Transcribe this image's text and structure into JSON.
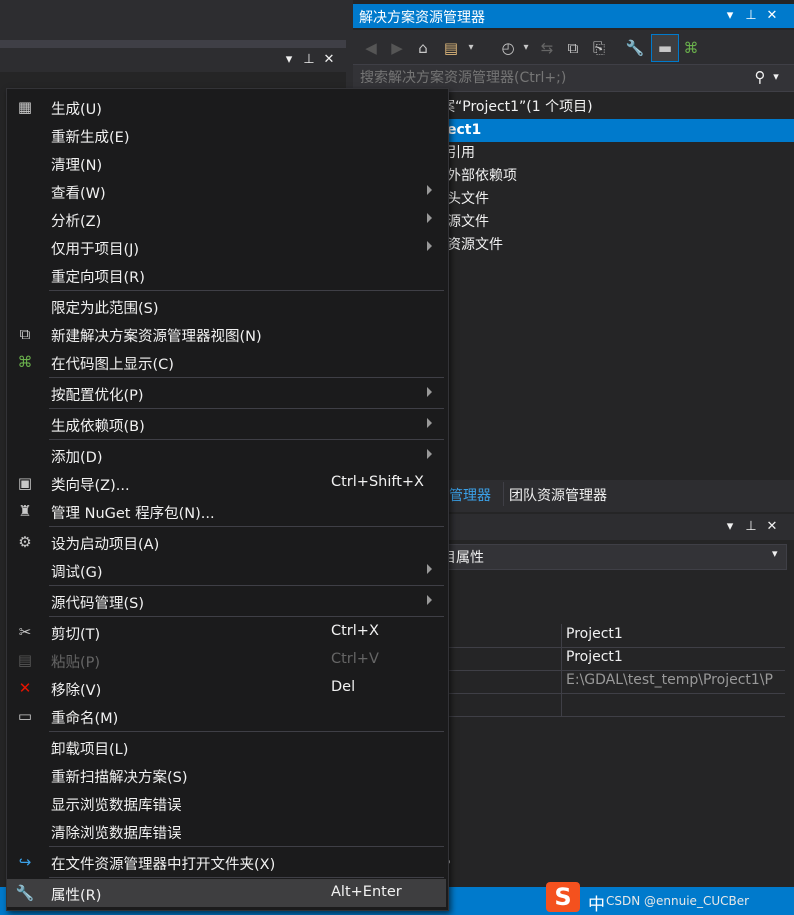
{
  "solution_explorer": {
    "title": "解决方案资源管理器",
    "search_placeholder": "搜索解决方案资源管理器(Ctrl+;)",
    "tree": [
      {
        "text": "案“Project1”(1 个项目)",
        "selected": false
      },
      {
        "text": "ect1",
        "selected": true
      },
      {
        "text": "引用",
        "selected": false
      },
      {
        "text": "外部依赖项",
        "selected": false
      },
      {
        "text": "头文件",
        "selected": false
      },
      {
        "text": "源文件",
        "selected": false
      },
      {
        "text": "资源文件",
        "selected": false
      }
    ],
    "bottom_tabs": [
      "管理器",
      "团队资源管理器"
    ]
  },
  "properties": {
    "combo_text": "目属性",
    "rows": [
      {
        "value": "Project1"
      },
      {
        "value": "Project1"
      },
      {
        "value": "E:\\GDAL\\test_temp\\Project1\\P"
      },
      {
        "value": ""
      }
    ],
    "footer_text": "。"
  },
  "ime": {
    "logo": "S",
    "lang": "中",
    "watermark": "CSDN @ennuie_CUCBer"
  },
  "context_menu": {
    "items": [
      {
        "id": "build",
        "label": "生成(U)",
        "icon": "build-icon",
        "glyph": "▦",
        "shortcut": "",
        "submenu": false,
        "disabled": false
      },
      {
        "id": "rebuild",
        "label": "重新生成(E)",
        "icon": "",
        "glyph": "",
        "shortcut": "",
        "submenu": false,
        "disabled": false
      },
      {
        "id": "clean",
        "label": "清理(N)",
        "icon": "",
        "glyph": "",
        "shortcut": "",
        "submenu": false,
        "disabled": false
      },
      {
        "id": "view",
        "label": "查看(W)",
        "icon": "",
        "glyph": "",
        "shortcut": "",
        "submenu": true,
        "disabled": false
      },
      {
        "id": "analyze",
        "label": "分析(Z)",
        "icon": "",
        "glyph": "",
        "shortcut": "",
        "submenu": true,
        "disabled": false
      },
      {
        "id": "project-only",
        "label": "仅用于项目(J)",
        "icon": "",
        "glyph": "",
        "shortcut": "",
        "submenu": true,
        "disabled": false
      },
      {
        "id": "retarget",
        "label": "重定向项目(R)",
        "icon": "",
        "glyph": "",
        "shortcut": "",
        "submenu": false,
        "disabled": false
      },
      {
        "id": "scope",
        "label": "限定为此范围(S)",
        "icon": "",
        "glyph": "",
        "shortcut": "",
        "submenu": false,
        "disabled": false
      },
      {
        "id": "new-view",
        "label": "新建解决方案资源管理器视图(N)",
        "icon": "new-view-icon",
        "glyph": "⧉",
        "shortcut": "",
        "submenu": false,
        "disabled": false
      },
      {
        "id": "code-map",
        "label": "在代码图上显示(C)",
        "icon": "code-map-icon",
        "glyph": "⌘",
        "shortcut": "",
        "submenu": false,
        "disabled": false
      },
      {
        "id": "pgo",
        "label": "按配置优化(P)",
        "icon": "",
        "glyph": "",
        "shortcut": "",
        "submenu": true,
        "disabled": false
      },
      {
        "id": "build-deps",
        "label": "生成依赖项(B)",
        "icon": "",
        "glyph": "",
        "shortcut": "",
        "submenu": true,
        "disabled": false
      },
      {
        "id": "add",
        "label": "添加(D)",
        "icon": "",
        "glyph": "",
        "shortcut": "",
        "submenu": true,
        "disabled": false
      },
      {
        "id": "class-wizard",
        "label": "类向导(Z)...",
        "icon": "class-wizard-icon",
        "glyph": "▣",
        "shortcut": "Ctrl+Shift+X",
        "submenu": false,
        "disabled": false
      },
      {
        "id": "nuget",
        "label": "管理 NuGet 程序包(N)...",
        "icon": "nuget-icon",
        "glyph": "♜",
        "shortcut": "",
        "submenu": false,
        "disabled": false
      },
      {
        "id": "startup",
        "label": "设为启动项目(A)",
        "icon": "gear-icon",
        "glyph": "⚙",
        "shortcut": "",
        "submenu": false,
        "disabled": false
      },
      {
        "id": "debug",
        "label": "调试(G)",
        "icon": "",
        "glyph": "",
        "shortcut": "",
        "submenu": true,
        "disabled": false
      },
      {
        "id": "source-control",
        "label": "源代码管理(S)",
        "icon": "",
        "glyph": "",
        "shortcut": "",
        "submenu": true,
        "disabled": false
      },
      {
        "id": "cut",
        "label": "剪切(T)",
        "icon": "scissors-icon",
        "glyph": "✂",
        "shortcut": "Ctrl+X",
        "submenu": false,
        "disabled": false
      },
      {
        "id": "paste",
        "label": "粘贴(P)",
        "icon": "paste-icon",
        "glyph": "▤",
        "shortcut": "Ctrl+V",
        "submenu": false,
        "disabled": true
      },
      {
        "id": "remove",
        "label": "移除(V)",
        "icon": "remove-icon",
        "glyph": "✕",
        "shortcut": "Del",
        "submenu": false,
        "disabled": false
      },
      {
        "id": "rename",
        "label": "重命名(M)",
        "icon": "rename-icon",
        "glyph": "▭",
        "shortcut": "",
        "submenu": false,
        "disabled": false
      },
      {
        "id": "unload",
        "label": "卸载项目(L)",
        "icon": "",
        "glyph": "",
        "shortcut": "",
        "submenu": false,
        "disabled": false
      },
      {
        "id": "rescan",
        "label": "重新扫描解决方案(S)",
        "icon": "",
        "glyph": "",
        "shortcut": "",
        "submenu": false,
        "disabled": false
      },
      {
        "id": "show-db-errors",
        "label": "显示浏览数据库错误",
        "icon": "",
        "glyph": "",
        "shortcut": "",
        "submenu": false,
        "disabled": false
      },
      {
        "id": "clear-db-errors",
        "label": "清除浏览数据库错误",
        "icon": "",
        "glyph": "",
        "shortcut": "",
        "submenu": false,
        "disabled": false
      },
      {
        "id": "open-folder",
        "label": "在文件资源管理器中打开文件夹(X)",
        "icon": "open-folder-icon",
        "glyph": "↪",
        "shortcut": "",
        "submenu": false,
        "disabled": false
      },
      {
        "id": "properties",
        "label": "属性(R)",
        "icon": "wrench-icon",
        "glyph": "🔧",
        "shortcut": "Alt+Enter",
        "submenu": false,
        "disabled": false,
        "highlighted": true
      }
    ]
  },
  "colors": {
    "accent": "#007acc",
    "remove_icon": "#e51400",
    "code_map_icon": "#6ab04c",
    "open_folder_icon": "#3ba1e8",
    "ime_logo": "#f4511e"
  }
}
